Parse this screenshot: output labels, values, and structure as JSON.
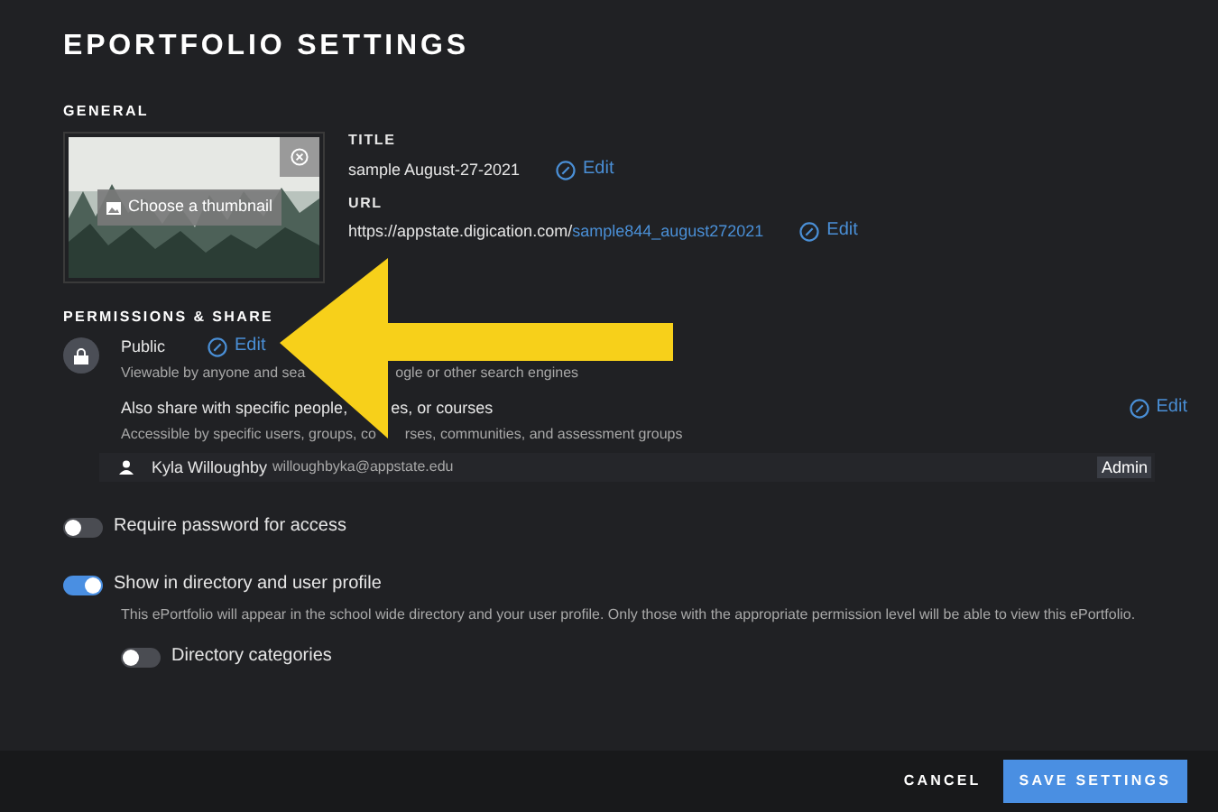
{
  "title": "EPORTFOLIO SETTINGS",
  "general": {
    "heading": "GENERAL",
    "thumbnail": {
      "button": "Choose a thumbnail"
    },
    "title_field": {
      "label": "TITLE",
      "value": "sample August-27-2021",
      "edit": "Edit"
    },
    "url_field": {
      "label": "URL",
      "prefix": "https://appstate.digication.com/",
      "slug": "sample844_august272021",
      "edit": "Edit"
    }
  },
  "permissions": {
    "heading": "PERMISSIONS & SHARE",
    "visibility": {
      "label": "Public",
      "edit": "Edit",
      "description": [
        "Viewable by anyone and sea",
        "ogle or other search engines"
      ]
    },
    "share": {
      "label": [
        "Also share with specific people,",
        "es, or courses"
      ],
      "description": [
        "Accessible by specific users, groups, co",
        "rses, communities, and assessment groups"
      ],
      "edit": "Edit"
    },
    "users": [
      {
        "name": "Kyla Willoughby",
        "email": "willoughbyka@appstate.edu",
        "role": "Admin"
      }
    ]
  },
  "options": [
    {
      "kind": "toggle",
      "label": "Require password for access",
      "on": false
    },
    {
      "kind": "toggle",
      "label": "Show in directory and user profile",
      "on": true,
      "description": "This ePortfolio will appear in the school wide directory and your user profile. Only those with the appropriate permission level will be able to view this ePortfolio.",
      "children": [
        {
          "kind": "toggle",
          "label": "Directory categories",
          "on": false
        }
      ]
    }
  ],
  "footer": {
    "cancel": "CANCEL",
    "save": "SAVE SETTINGS"
  }
}
